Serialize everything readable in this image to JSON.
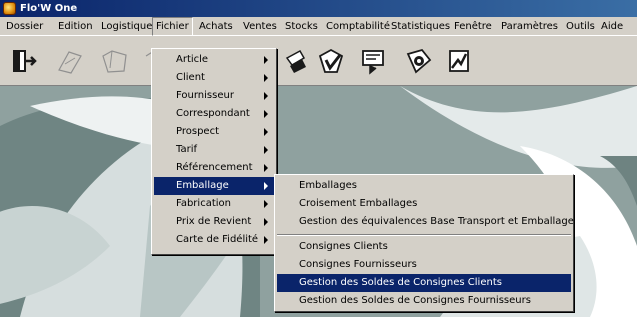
{
  "window": {
    "title": "Flo'W One",
    "icon": "app-flower-icon"
  },
  "menubar": {
    "items": [
      "Dossier",
      "Edition",
      "Logistique",
      "Fichier",
      "Achats",
      "Ventes",
      "Stocks",
      "Comptabilité",
      "Statistiques",
      "Fenêtre",
      "Paramètres",
      "Outils",
      "Aide"
    ],
    "active": "Fichier"
  },
  "toolbar": {
    "buttons": [
      "exit-door-icon",
      "article-icon",
      "client-icon",
      "emballage-icon",
      "document-icon",
      "stock-icon",
      "statistics-icon",
      "payment-icon"
    ]
  },
  "fichier_menu": {
    "items": [
      {
        "label": "Article",
        "submenu": true
      },
      {
        "label": "Client",
        "submenu": true
      },
      {
        "label": "Fournisseur",
        "submenu": true
      },
      {
        "label": "Correspondant",
        "submenu": true
      },
      {
        "label": "Prospect",
        "submenu": true
      },
      {
        "label": "Tarif",
        "submenu": true
      },
      {
        "label": "Référencement",
        "submenu": true
      },
      {
        "label": "Emballage",
        "submenu": true
      },
      {
        "label": "Fabrication",
        "submenu": true
      },
      {
        "label": "Prix de Revient",
        "submenu": true
      },
      {
        "label": "Carte de Fidélité",
        "submenu": true
      }
    ],
    "highlighted": "Emballage"
  },
  "emballage_menu": {
    "items": [
      {
        "label": "Emballages"
      },
      {
        "label": "Croisement Emballages"
      },
      {
        "label": "Gestion des équivalences Base Transport et Emballage"
      },
      {
        "label": "Consignes Clients"
      },
      {
        "label": "Consignes Fournisseurs"
      },
      {
        "label": "Gestion des Soldes de Consignes Clients"
      },
      {
        "label": "Gestion des Soldes de Consignes Fournisseurs"
      }
    ],
    "highlighted": "Gestion des Soldes de Consignes Clients"
  },
  "colors": {
    "title_bar": "#0a246a",
    "menu_bg": "#d4d0c8",
    "selection": "#0a246a",
    "workspace": "#9aa7a6"
  }
}
